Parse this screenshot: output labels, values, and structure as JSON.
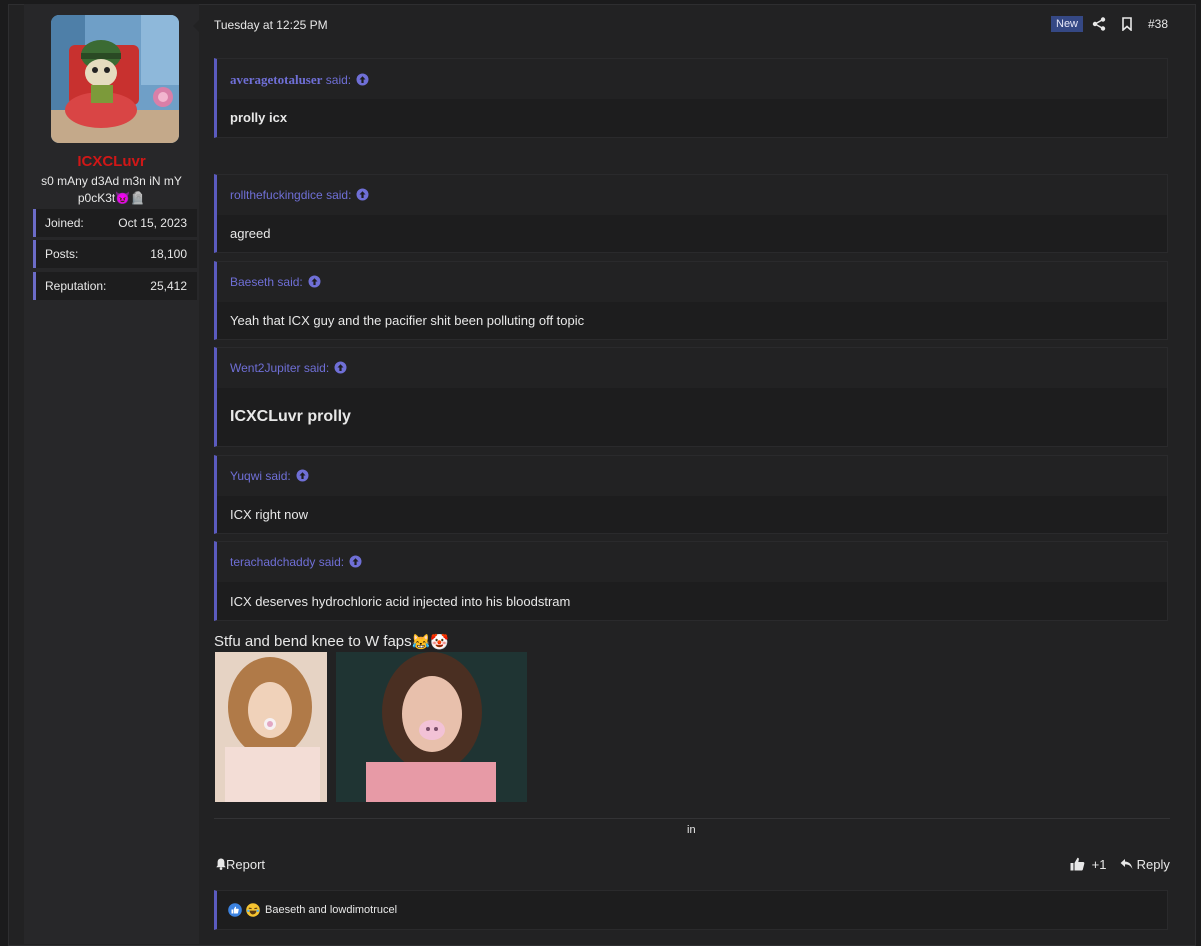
{
  "user": {
    "name": "ICXCLuvr",
    "title": "s0 mAny d3Ad m3n iN mY p0cK3t",
    "title_emoji": "😈🪦",
    "stats": [
      {
        "label": "Joined:",
        "value": "Oct 15, 2023"
      },
      {
        "label": "Posts:",
        "value": "18,100"
      },
      {
        "label": "Reputation:",
        "value": "25,412"
      }
    ]
  },
  "post": {
    "date": "Tuesday at 12:25 PM",
    "new_badge": "New",
    "number": "#38",
    "quotes": [
      {
        "author": "averagetotaluser",
        "said": "said:",
        "text": "prolly icx"
      },
      {
        "author": "rollthefuckingdice",
        "said": "said:",
        "text": "agreed"
      },
      {
        "author": "Baeseth",
        "said": "said:",
        "text": "Yeah that ICX guy and the pacifier shit been polluting off topic"
      },
      {
        "author": "Went2Jupiter",
        "said": "said:",
        "text": "ICXCLuvr prolly"
      },
      {
        "author": "Yuqwi",
        "said": "said:",
        "text": "ICX right now"
      },
      {
        "author": "terachadchaddy",
        "said": "said:",
        "text": "ICX deserves hydrochloric acid injected into his bloodstram"
      }
    ],
    "message": "Stfu and bend knee to W faps",
    "message_emoji": "😹🤡",
    "footer_in": "in",
    "report_label": "Report",
    "like_label": "+1",
    "reply_label": "Reply",
    "reactions_text": "Baeseth and lowdimotrucel"
  },
  "colors": {
    "username": "#d01717",
    "quote_accent": "#5b5bbf",
    "link": "#6f6fd6"
  },
  "icons": [
    "share-icon",
    "bookmark-icon",
    "arrow-up-circle-icon",
    "bell-icon",
    "thumbs-up-icon",
    "reply-icon",
    "like-reaction-icon",
    "laugh-reaction-icon"
  ]
}
